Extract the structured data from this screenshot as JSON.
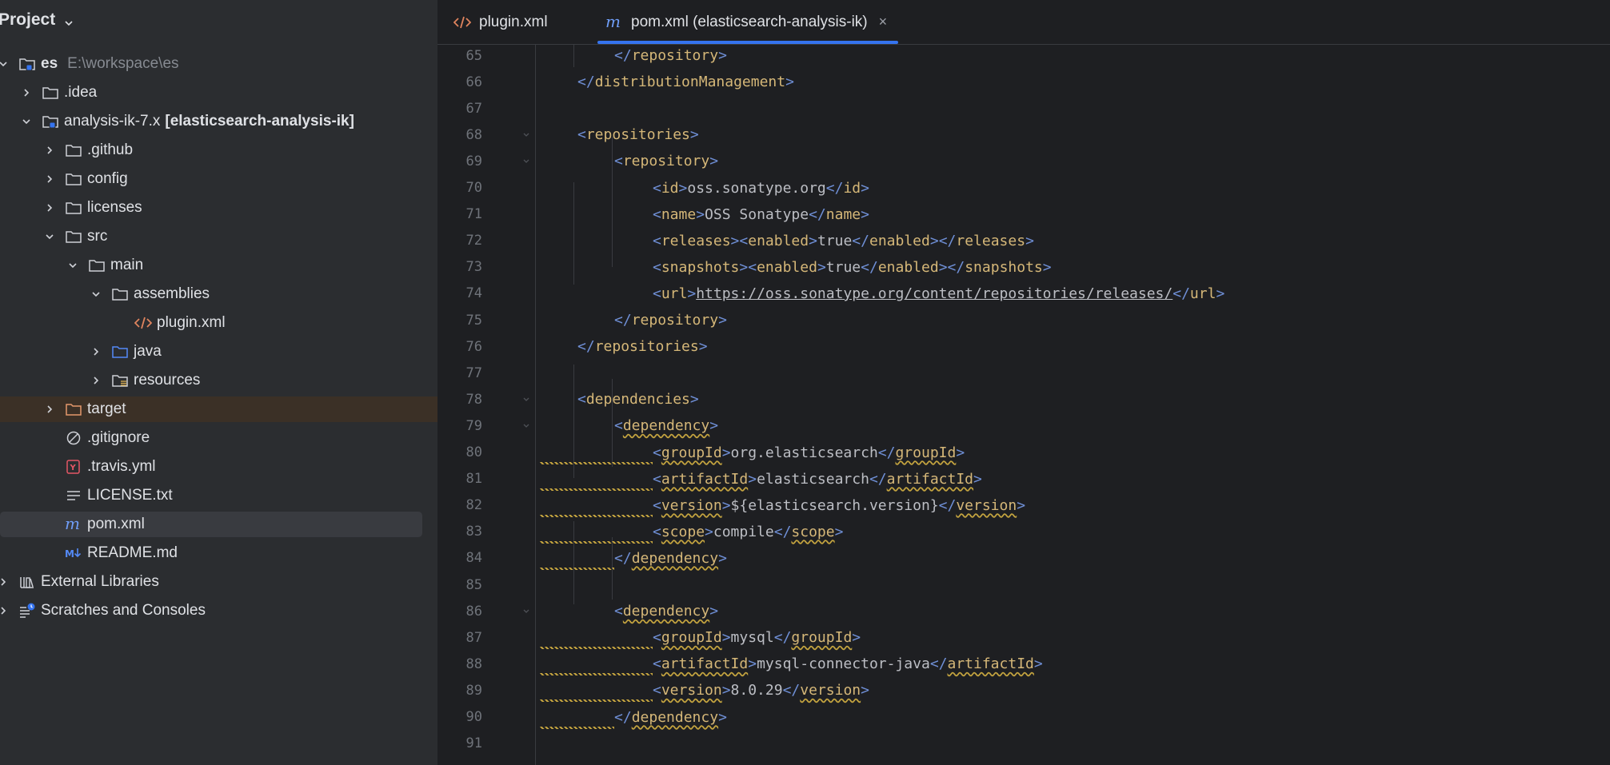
{
  "sidebar": {
    "title": "Project",
    "items": [
      {
        "label": "es",
        "path": "E:\\workspace\\es",
        "depth": 0,
        "arrow": "down",
        "icon": "module-folder-icon"
      },
      {
        "label": ".idea",
        "depth": 1,
        "arrow": "right",
        "icon": "folder-icon"
      },
      {
        "label": "analysis-ik-7.x",
        "module": "[elasticsearch-analysis-ik]",
        "depth": 1,
        "arrow": "down",
        "icon": "module-folder-icon"
      },
      {
        "label": ".github",
        "depth": 2,
        "arrow": "right",
        "icon": "folder-icon"
      },
      {
        "label": "config",
        "depth": 2,
        "arrow": "right",
        "icon": "folder-icon"
      },
      {
        "label": "licenses",
        "depth": 2,
        "arrow": "right",
        "icon": "folder-icon"
      },
      {
        "label": "src",
        "depth": 2,
        "arrow": "down",
        "icon": "folder-icon"
      },
      {
        "label": "main",
        "depth": 3,
        "arrow": "down",
        "icon": "folder-icon"
      },
      {
        "label": "assemblies",
        "depth": 4,
        "arrow": "down",
        "icon": "folder-icon"
      },
      {
        "label": "plugin.xml",
        "depth": 5,
        "arrow": "none",
        "icon": "xml-file-icon"
      },
      {
        "label": "java",
        "depth": 4,
        "arrow": "right",
        "icon": "source-folder-icon"
      },
      {
        "label": "resources",
        "depth": 4,
        "arrow": "right",
        "icon": "resources-folder-icon"
      },
      {
        "label": "target",
        "depth": 2,
        "arrow": "right",
        "icon": "excluded-folder-icon"
      },
      {
        "label": ".gitignore",
        "depth": 2,
        "arrow": "none",
        "icon": "gitignore-icon"
      },
      {
        "label": ".travis.yml",
        "depth": 2,
        "arrow": "none",
        "icon": "yaml-file-icon"
      },
      {
        "label": "LICENSE.txt",
        "depth": 2,
        "arrow": "none",
        "icon": "text-file-icon"
      },
      {
        "label": "pom.xml",
        "depth": 2,
        "arrow": "none",
        "icon": "maven-file-icon"
      },
      {
        "label": "README.md",
        "depth": 2,
        "arrow": "none",
        "icon": "markdown-file-icon"
      },
      {
        "label": "External Libraries",
        "depth": 0,
        "arrow": "right",
        "icon": "libraries-icon"
      },
      {
        "label": "Scratches and Consoles",
        "depth": 0,
        "arrow": "right",
        "icon": "scratches-icon"
      }
    ]
  },
  "tabs": [
    {
      "label": "plugin.xml",
      "icon": "xml-file-icon",
      "active": false
    },
    {
      "label": "pom.xml (elasticsearch-analysis-ik)",
      "icon": "maven-file-icon",
      "active": true,
      "close": "×"
    }
  ],
  "code": {
    "lines": [
      {
        "n": "65"
      },
      {
        "n": "66"
      },
      {
        "n": "67"
      },
      {
        "n": "68"
      },
      {
        "n": "69"
      },
      {
        "n": "70"
      },
      {
        "n": "71"
      },
      {
        "n": "72"
      },
      {
        "n": "73"
      },
      {
        "n": "74"
      },
      {
        "n": "75"
      },
      {
        "n": "76"
      },
      {
        "n": "77"
      },
      {
        "n": "78"
      },
      {
        "n": "79"
      },
      {
        "n": "80"
      },
      {
        "n": "81"
      },
      {
        "n": "82"
      },
      {
        "n": "83"
      },
      {
        "n": "84"
      },
      {
        "n": "85"
      },
      {
        "n": "86"
      },
      {
        "n": "87"
      },
      {
        "n": "88"
      },
      {
        "n": "89"
      },
      {
        "n": "90"
      },
      {
        "n": "91"
      }
    ],
    "text": {
      "repository": "repository",
      "distributionManagement": "distributionManagement",
      "repositories": "repositories",
      "id": "id",
      "id_val": "oss.sonatype.org",
      "name": "name",
      "name_val": "OSS Sonatype",
      "releases": "releases",
      "enabled": "enabled",
      "true_val": "true",
      "snapshots": "snapshots",
      "url": "url",
      "url_val": "https://oss.sonatype.org/content/repositories/releases/",
      "dependencies": "dependencies",
      "dependency": "dependency",
      "groupId": "groupId",
      "artifactId": "artifactId",
      "version": "version",
      "scope": "scope",
      "g1": "org.elasticsearch",
      "a1": "elasticsearch",
      "v1": "${elasticsearch.version}",
      "s1": "compile",
      "g2": "mysql",
      "a2": "mysql-connector-java",
      "v2": "8.0.29"
    }
  },
  "colors": {
    "sidebar_bg": "#2b2d30",
    "editor_bg": "#1e1f22",
    "tab_underline": "#3574f0",
    "tag_name": "#d5b778",
    "bracket": "#6f8fd6",
    "warning": "#c3a33f"
  }
}
